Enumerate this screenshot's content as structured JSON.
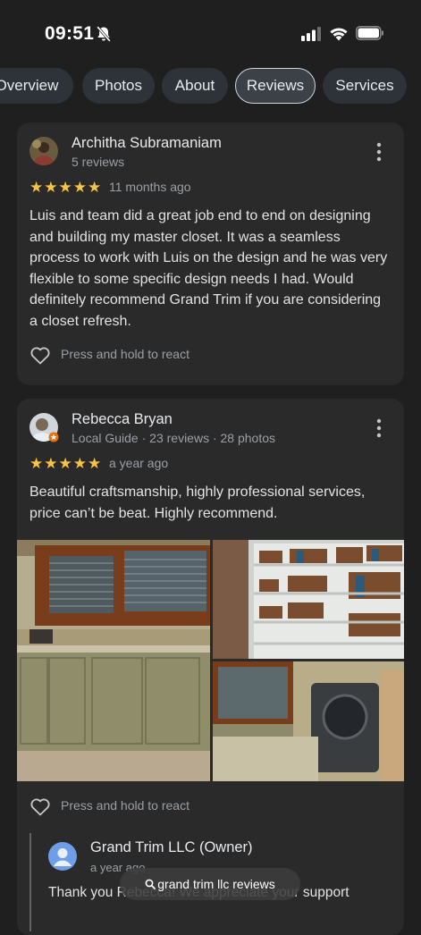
{
  "status_bar": {
    "time": "09:51"
  },
  "tabs": [
    {
      "label": "Overview"
    },
    {
      "label": "Photos"
    },
    {
      "label": "About"
    },
    {
      "label": "Reviews"
    },
    {
      "label": "Services"
    }
  ],
  "reviews": [
    {
      "author": "Architha Subramaniam",
      "meta": "5 reviews",
      "rating": 5,
      "stars": "★★★★★",
      "when": "11 months ago",
      "text": "Luis and team did a great job end to end on designing and building my master closet. It was a seamless process to work with Luis on the design and he was very flexible to some specific design needs I had. Would definitely recommend Grand Trim if you are considering a closet refresh.",
      "react_label": "Press and hold to react"
    },
    {
      "author": "Rebecca Bryan",
      "meta": "Local Guide · 23 reviews · 28 photos",
      "rating": 5,
      "stars": "★★★★★",
      "when": "a year ago",
      "text": "Beautiful craftsmanship, highly professional services, price can’t be beat. Highly recommend.",
      "react_label": "Press and hold to react",
      "owner_reply": {
        "name": "Grand Trim LLC (Owner)",
        "when": "a year ago",
        "text": "Thank you Rebecca! We appreciate your support"
      }
    }
  ],
  "search_pill": {
    "label": "grand trim llc reviews"
  },
  "icons": [
    "bell-off-icon",
    "signal-icon",
    "wifi-icon",
    "battery-icon",
    "more-vert-icon",
    "heart-outline-icon",
    "search-icon",
    "owner-avatar-icon"
  ],
  "colors": {
    "background": "#1f1f1f",
    "card": "#2a2a2a",
    "star": "#f6c445",
    "tab": "#2d3338"
  }
}
